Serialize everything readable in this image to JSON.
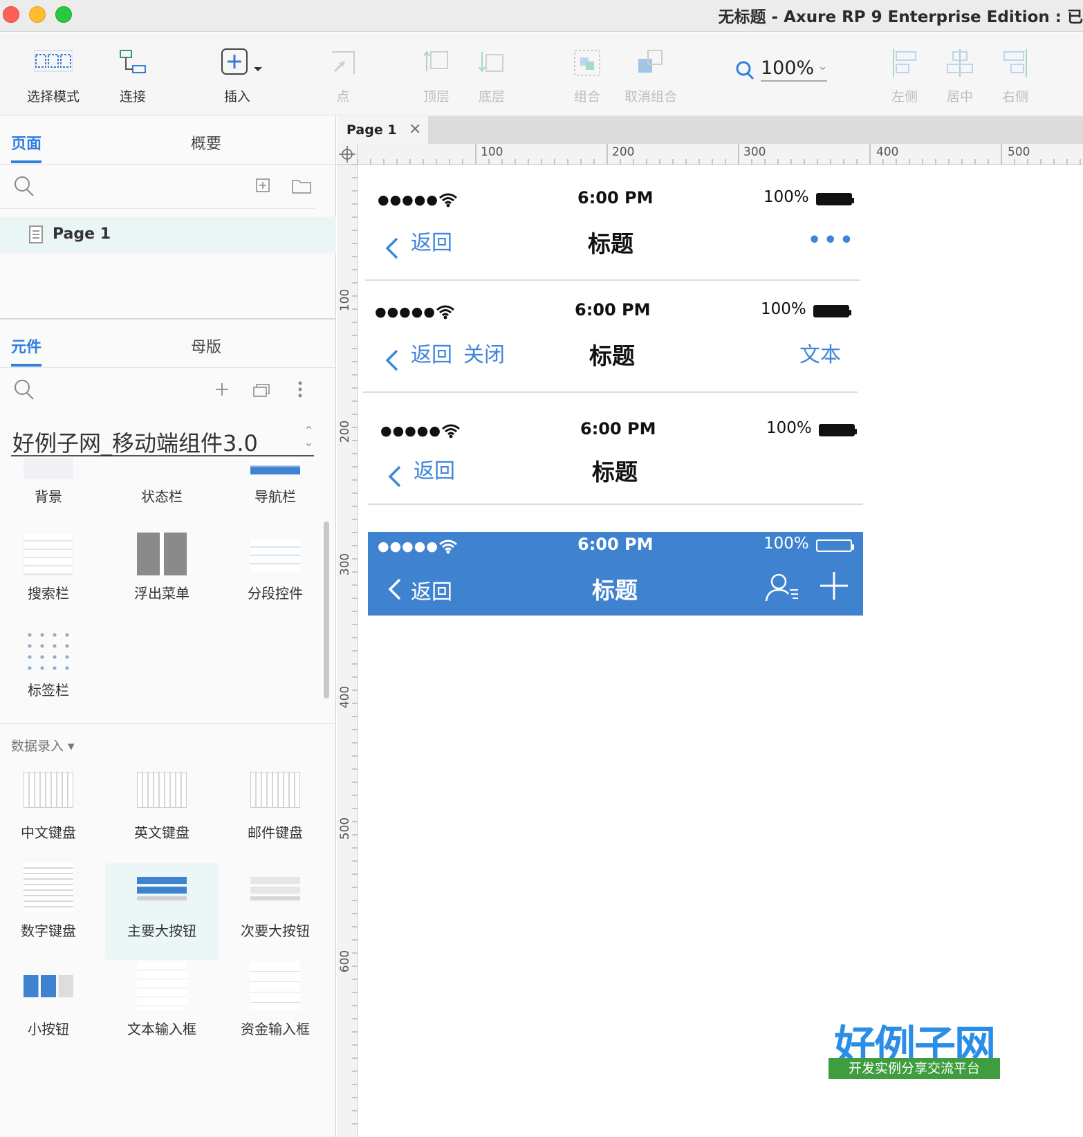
{
  "window": {
    "title": "无标题 - Axure RP 9 Enterprise Edition : 已"
  },
  "toolbar": {
    "select_mode": "选择模式",
    "connect": "连接",
    "insert": "插入",
    "point": "点",
    "bring_front": "顶层",
    "send_back": "底层",
    "group": "组合",
    "ungroup": "取消组合",
    "zoom": "100%",
    "align_left": "左侧",
    "align_center": "居中",
    "align_right": "右侧"
  },
  "pages_panel": {
    "tab_pages": "页面",
    "tab_outline": "概要",
    "page_item": "Page 1"
  },
  "library_panel": {
    "tab_widgets": "元件",
    "tab_masters": "母版",
    "library_name": "好例子网_移动端组件3.0",
    "widgets_row1": [
      "背景",
      "状态栏",
      "导航栏"
    ],
    "widgets_row2": [
      "搜索栏",
      "浮出菜单",
      "分段控件"
    ],
    "widgets_row3": [
      "标签栏"
    ],
    "section_data_input": "数据录入 ▾",
    "widgets_row4": [
      "中文键盘",
      "英文键盘",
      "邮件键盘"
    ],
    "widgets_row5": [
      "数字键盘",
      "主要大按钮",
      "次要大按钮"
    ],
    "widgets_row6": [
      "小按钮",
      "文本输入框",
      "资金输入框"
    ]
  },
  "canvas": {
    "tab_label": "Page 1",
    "tab_close": "×",
    "ruler_top": [
      "100",
      "200",
      "300",
      "400",
      "500"
    ],
    "ruler_left": [
      "100",
      "200",
      "300",
      "400",
      "500",
      "600"
    ],
    "navbars": [
      {
        "signal": "●●●●●",
        "time": "6:00 PM",
        "battery": "100%",
        "back": "返回",
        "title": "标题",
        "right": "•••"
      },
      {
        "signal": "●●●●●",
        "time": "6:00 PM",
        "battery": "100%",
        "back": "返回",
        "close": "关闭",
        "title": "标题",
        "right": "文本"
      },
      {
        "signal": "●●●●●",
        "time": "6:00 PM",
        "battery": "100%",
        "back": "返回",
        "title": "标题"
      },
      {
        "signal": "●●●●●",
        "time": "6:00 PM",
        "battery": "100%",
        "back": "返回",
        "title": "标题"
      }
    ]
  },
  "badge": {
    "main": "好例子网",
    "sub": "开发实例分享交流平台"
  },
  "colors": {
    "accent": "#2f7ee0",
    "navbar_blue": "#3f82cf",
    "link_blue": "#3f86d9"
  }
}
